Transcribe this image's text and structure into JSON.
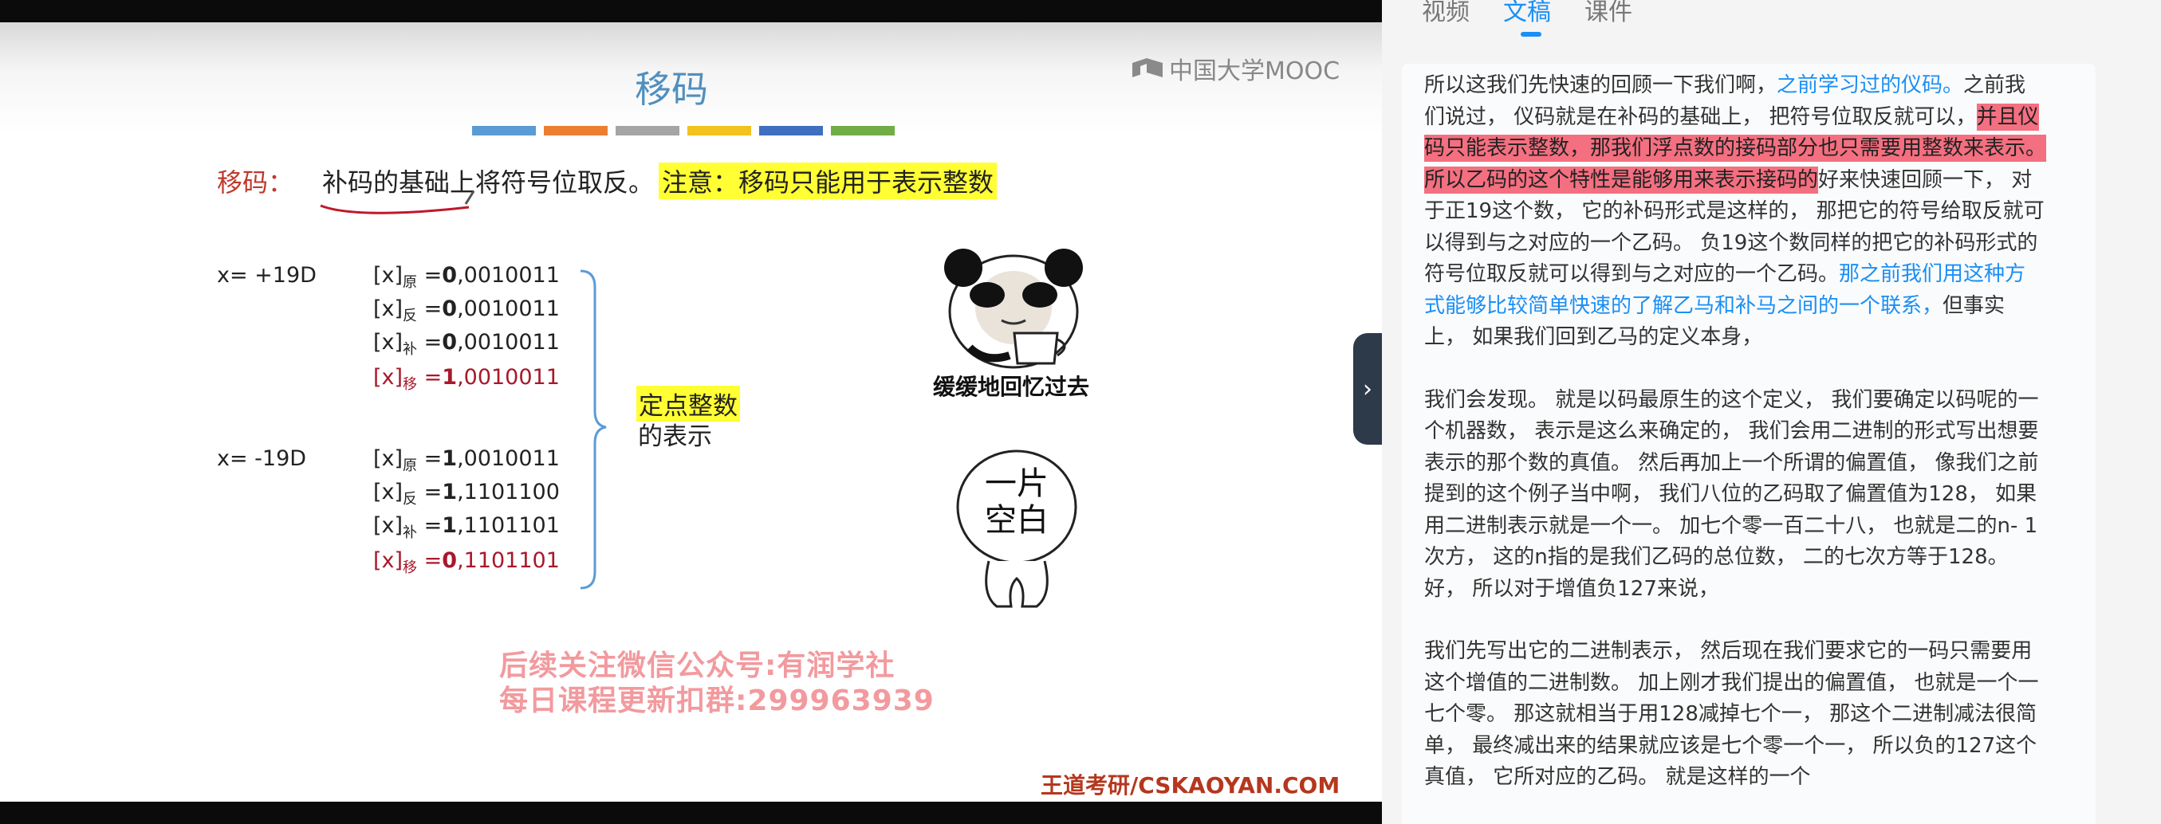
{
  "colors": {
    "accent": "#1a8ff5",
    "highlight_pink": "#f46f80",
    "definition_red": "#c0392b",
    "code_red": "#a8182b",
    "note_yellow": "#ffff33"
  },
  "slide": {
    "title": "移码",
    "logo_text": "中国大学MOOC",
    "color_strip": [
      "#5b9bd5",
      "#ed7d31",
      "#a5a5a5",
      "#f2c21d",
      "#3f6fbf",
      "#70ad47"
    ],
    "definition_label": "移码：",
    "definition_text": "补码的基础上将符号位取反。",
    "definition_note": "注意：移码只能用于表示整数",
    "example1_label": "x= +19D",
    "example1_rows": [
      {
        "prefix": "[x]",
        "sub": "原",
        "eq": " =",
        "sign": "0",
        "rest": ",0010011"
      },
      {
        "prefix": "[x]",
        "sub": "反",
        "eq": " =",
        "sign": "0",
        "rest": ",0010011"
      },
      {
        "prefix": "[x]",
        "sub": "补",
        "eq": " =",
        "sign": "0",
        "rest": ",0010011"
      },
      {
        "prefix": "[x]",
        "sub": "移",
        "eq": " =",
        "sign": "1",
        "rest": ",0010011"
      }
    ],
    "example2_label": "x= -19D",
    "example2_rows": [
      {
        "prefix": "[x]",
        "sub": "原",
        "eq": " =",
        "sign": "1",
        "rest": ",0010011"
      },
      {
        "prefix": "[x]",
        "sub": "反",
        "eq": " =",
        "sign": "1",
        "rest": ",1101100"
      },
      {
        "prefix": "[x]",
        "sub": "补",
        "eq": " =",
        "sign": "1",
        "rest": ",1101101"
      },
      {
        "prefix": "[x]",
        "sub": "移",
        "eq": " =",
        "sign": "0",
        "rest": ",1101101"
      }
    ],
    "fixed_int_highlight": "定点整数",
    "fixed_int_rest": "的表示",
    "meme_caption": "缓缓地回忆过去",
    "blank_text_1": "一片",
    "blank_text_2": "空白",
    "watermark_1": "后续关注微信公众号:有润学社",
    "watermark_2": "每日课程更新扣群:299963939",
    "footer": "王道考研/CSKAOYAN.COM"
  },
  "sidebar_toggle": "›",
  "panel": {
    "tabs": [
      {
        "label": "视频",
        "active": false
      },
      {
        "label": "文稿",
        "active": true
      },
      {
        "label": "课件",
        "active": false
      }
    ],
    "paragraph1": {
      "t1": "所以这我们先快速的回顾一下我们啊，",
      "t2": "之前学习过的仪码。",
      "t3": "之前我们说过， 仪码就是在补码的基础上， 把符号位取反就可以，",
      "t4": "并且仪码只能表示整数，那我们浮点数的接码部分也只需要用整数来表示。 所以乙码的这个特性是能够用来表示接码的",
      "t5": "好来快速回顾一下， 对于正19这个数， 它的补码形式是这样的， 那把它的符号给取反就可以得到与之对应的一个乙码。 负19这个数同样的把它的补码形式的符号位取反就可以得到与之对应的一个乙码。",
      "t6": "那之前我们用这种方式能够比较简单快速的了解乙马和补马之间的一个联系，",
      "t7": "但事实上， 如果我们回到乙马的定义本身，"
    },
    "paragraph2": "我们会发现。 就是以码最原生的这个定义， 我们要确定以码呢的一个机器数， 表示是这么来确定的， 我们会用二进制的形式写出想要表示的那个数的真值。 然后再加上一个所谓的偏置值， 像我们之前提到的这个例子当中啊， 我们八位的乙码取了偏置值为128， 如果用二进制表示就是一个一。 加七个零一百二十八， 也就是二的n- 1次方， 这的n指的是我们乙码的总位数， 二的七次方等于128。 好， 所以对于增值负127来说，",
    "paragraph3": "我们先写出它的二进制表示， 然后现在我们要求它的一码只需要用这个增值的二进制数。 加上刚才我们提出的偏置值， 也就是一个一七个零。 那这就相当于用128减掉七个一， 那这个二进制减法很简单， 最终减出来的结果就应该是七个零一个一， 所以负的127这个真值， 它所对应的乙码。 就是这样的一个"
  }
}
